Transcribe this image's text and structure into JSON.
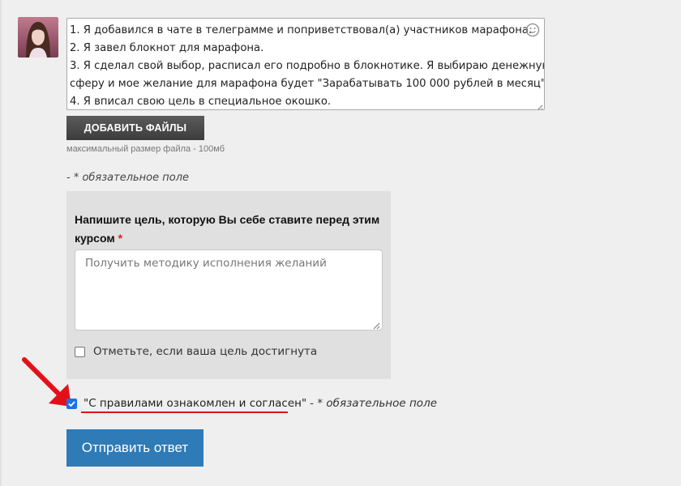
{
  "comment": {
    "lines": [
      "1. Я добавился  в чате в телеграмме и поприветствовал(а) участников марафона.",
      "2. Я завел блокнот для марафона.",
      "3. Я сделал свой выбор, расписал его подробно в блокнотике. Я выбираю денежную",
      "сферу и мое желание для марафона будет \"Зарабатывать 100 000 рублей в месяц\".",
      "4. Я вписал свою цель в специальное окошко."
    ],
    "emoji_icon": "smile-icon"
  },
  "files": {
    "button_label": "ДОБАВИТЬ ФАЙЛЫ",
    "max_size": "максимальный размер файла - 100мб"
  },
  "required_note": {
    "prefix": "- ",
    "text": "* обязательное поле"
  },
  "goal": {
    "title": "Напишите цель, которую Вы себе ставите перед этим курсом",
    "star": "*",
    "placeholder": "Получить методику исполнения желаний",
    "achieved_label": "Отметьте, если ваша цель достигнута",
    "achieved_checked": false
  },
  "agreement": {
    "label": "\"С правилами ознакомлен и согласен\"",
    "separator": " - ",
    "note": "* обязательное поле",
    "checked": true
  },
  "submit": {
    "label": "Отправить ответ"
  },
  "colors": {
    "accent": "#2e7bb7",
    "annotation": "#e3101a",
    "checkbox_checked": "#1a73e8"
  }
}
